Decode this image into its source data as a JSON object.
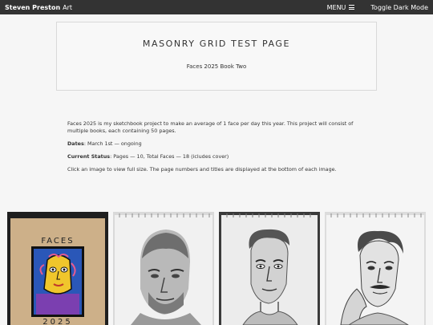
{
  "navbar": {
    "brand_name": "Steven Preston",
    "brand_suffix": "Art",
    "menu_label": "MENU",
    "dark_mode_label": "Toggle Dark Mode"
  },
  "header": {
    "title": "MASONRY GRID TEST PAGE",
    "subtitle": "Faces 2025 Book Two"
  },
  "intro": {
    "description": "Faces 2025 is my sketchbook project to make an average of 1 face per day this year. This project will consist of multiple books, each containing 50 pages.",
    "dates_label": "Dates",
    "dates_value": ": March 1st — ongoing",
    "status_label": "Current Status",
    "status_value": ": Pages — 10, Total Faces — 18 (icludes cover)",
    "instructions": "Click an image to view full size. The page numbers and titles are displayed at the bottom of each image."
  },
  "gallery": {
    "cover_title": "FACES",
    "cover_year": "2025"
  }
}
